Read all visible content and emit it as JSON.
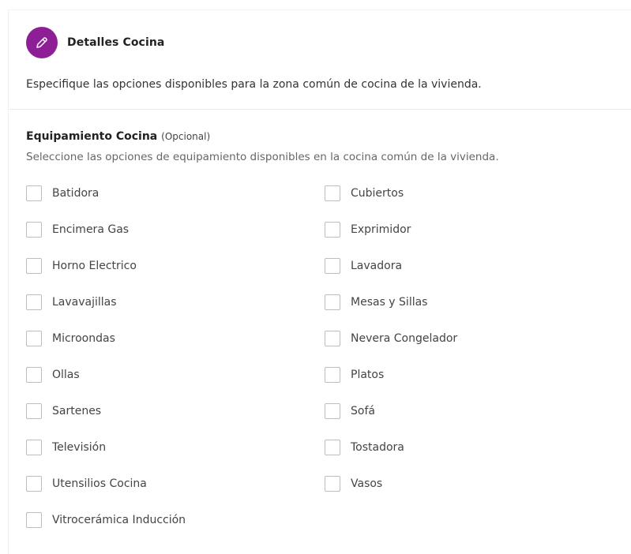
{
  "section": {
    "title": "Detalles Cocina",
    "icon": "pencil-icon",
    "description": "Especifique las opciones disponibles para la zona común de cocina de la vivienda."
  },
  "group": {
    "title": "Equipamiento Cocina",
    "optional_label": "(Opcional)",
    "description": "Seleccione las opciones de equipamiento disponibles en la cocina común de la vivienda."
  },
  "options_left": [
    {
      "label": "Batidora",
      "checked": false
    },
    {
      "label": "Encimera Gas",
      "checked": false
    },
    {
      "label": "Horno Electrico",
      "checked": false
    },
    {
      "label": "Lavavajillas",
      "checked": false
    },
    {
      "label": "Microondas",
      "checked": false
    },
    {
      "label": "Ollas",
      "checked": false
    },
    {
      "label": "Sartenes",
      "checked": false
    },
    {
      "label": "Televisión",
      "checked": false
    },
    {
      "label": "Utensilios Cocina",
      "checked": false
    },
    {
      "label": "Vitrocerámica Inducción",
      "checked": false
    }
  ],
  "options_right": [
    {
      "label": "Cubiertos",
      "checked": false
    },
    {
      "label": "Exprimidor",
      "checked": false
    },
    {
      "label": "Lavadora",
      "checked": false
    },
    {
      "label": "Mesas y Sillas",
      "checked": false
    },
    {
      "label": "Nevera Congelador",
      "checked": false
    },
    {
      "label": "Platos",
      "checked": false
    },
    {
      "label": "Sofá",
      "checked": false
    },
    {
      "label": "Tostadora",
      "checked": false
    },
    {
      "label": "Vasos",
      "checked": false
    }
  ],
  "colors": {
    "accent": "#8e1e96"
  }
}
